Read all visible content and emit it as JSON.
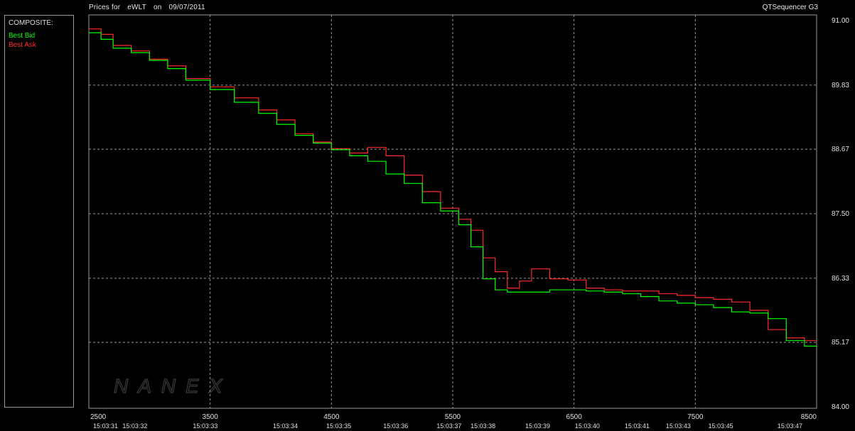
{
  "header": {
    "title_parts": [
      "Prices for",
      "eWLT",
      "on",
      "09/07/2011"
    ],
    "brand": "QTSequencer G3"
  },
  "legend": {
    "heading": "COMPOSITE:",
    "bid_label": "Best Bid",
    "ask_label": "Best Ask"
  },
  "watermark": "NANEX",
  "colors": {
    "bid": "#00ff00",
    "ask": "#ff2a2a",
    "grid": "#9a9a9a",
    "background": "#000000"
  },
  "chart_data": {
    "type": "line",
    "title": "Prices for  eWLT  on  09/07/2011",
    "ylim": [
      84.0,
      91.0
    ],
    "xlim": [
      2500,
      8500
    ],
    "y_ticks": [
      "91.00",
      "89.83",
      "88.67",
      "87.50",
      "86.33",
      "85.17",
      "84.00"
    ],
    "y_tick_values": [
      91.0,
      89.83,
      88.67,
      87.5,
      86.33,
      85.17,
      84.0
    ],
    "x_ticks": [
      "2500",
      "3500",
      "4500",
      "5500",
      "6500",
      "7500",
      "8500"
    ],
    "x_tick_values": [
      2500,
      3500,
      4500,
      5500,
      6500,
      7500,
      8500
    ],
    "time_labels": [
      {
        "x": 2500,
        "t": "15:03:31"
      },
      {
        "x": 2880,
        "t": "15:03:32"
      },
      {
        "x": 3460,
        "t": "15:03:33"
      },
      {
        "x": 4120,
        "t": "15:03:34"
      },
      {
        "x": 4560,
        "t": "15:03:35"
      },
      {
        "x": 5030,
        "t": "15:03:36"
      },
      {
        "x": 5470,
        "t": "15:03:37"
      },
      {
        "x": 5750,
        "t": "15:03:38"
      },
      {
        "x": 6200,
        "t": "15:03:39"
      },
      {
        "x": 6610,
        "t": "15:03:40"
      },
      {
        "x": 7020,
        "t": "15:03:41"
      },
      {
        "x": 7360,
        "t": "15:03:43"
      },
      {
        "x": 7710,
        "t": "15:03:45"
      },
      {
        "x": 8280,
        "t": "15:03:47"
      }
    ],
    "series": [
      {
        "name": "Best Bid",
        "x": [
          2500,
          2600,
          2700,
          2850,
          3000,
          3150,
          3300,
          3500,
          3700,
          3900,
          4050,
          4200,
          4350,
          4500,
          4650,
          4800,
          4950,
          5100,
          5250,
          5400,
          5550,
          5650,
          5750,
          5850,
          5950,
          6050,
          6150,
          6300,
          6450,
          6600,
          6750,
          6900,
          7050,
          7200,
          7350,
          7500,
          7650,
          7800,
          7950,
          8100,
          8250,
          8400,
          8500
        ],
        "y": [
          90.78,
          90.66,
          90.5,
          90.42,
          90.28,
          90.13,
          89.92,
          89.75,
          89.52,
          89.32,
          89.12,
          88.92,
          88.78,
          88.66,
          88.55,
          88.45,
          88.22,
          88.05,
          87.7,
          87.55,
          87.3,
          86.9,
          86.32,
          86.12,
          86.08,
          86.08,
          86.08,
          86.12,
          86.12,
          86.1,
          86.08,
          86.05,
          86.0,
          85.92,
          85.88,
          85.85,
          85.8,
          85.72,
          85.7,
          85.6,
          85.2,
          85.1,
          85.08
        ]
      },
      {
        "name": "Best Ask",
        "x": [
          2500,
          2600,
          2700,
          2850,
          3000,
          3150,
          3300,
          3500,
          3700,
          3900,
          4050,
          4200,
          4350,
          4500,
          4650,
          4800,
          4950,
          5100,
          5250,
          5400,
          5550,
          5650,
          5750,
          5850,
          5950,
          6050,
          6150,
          6300,
          6450,
          6600,
          6750,
          6900,
          7050,
          7200,
          7350,
          7500,
          7650,
          7800,
          7950,
          8100,
          8250,
          8400,
          8500
        ],
        "y": [
          90.85,
          90.75,
          90.55,
          90.45,
          90.3,
          90.18,
          89.95,
          89.8,
          89.6,
          89.38,
          89.2,
          88.95,
          88.8,
          88.68,
          88.6,
          88.7,
          88.55,
          88.2,
          87.9,
          87.6,
          87.4,
          87.2,
          86.7,
          86.45,
          86.15,
          86.28,
          86.5,
          86.32,
          86.3,
          86.15,
          86.12,
          86.1,
          86.1,
          86.05,
          86.02,
          85.98,
          85.95,
          85.9,
          85.75,
          85.4,
          85.25,
          85.2,
          85.2
        ]
      }
    ],
    "grid": true,
    "legend_position": "left-panel"
  }
}
